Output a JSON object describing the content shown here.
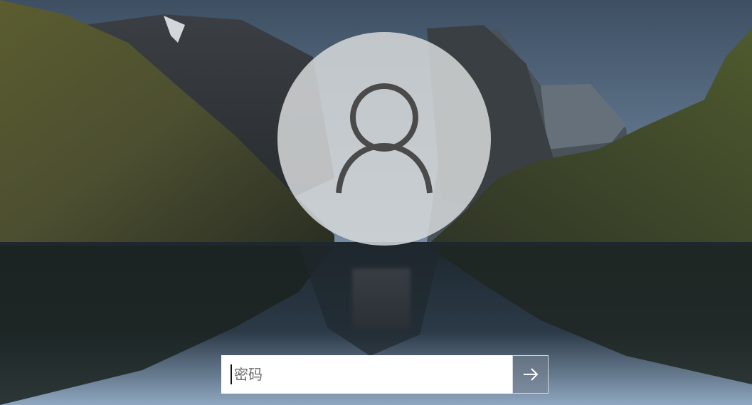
{
  "background": {
    "name": "mountain-lake-wallpaper",
    "colors": {
      "sky": "#5f7894",
      "water": "#24323e",
      "cliff": "#4a4f33"
    }
  },
  "user": {
    "avatar_icon": "user-icon",
    "name_obscured": true
  },
  "password": {
    "value": "",
    "placeholder": "密码",
    "submit_icon": "arrow-right-icon"
  }
}
